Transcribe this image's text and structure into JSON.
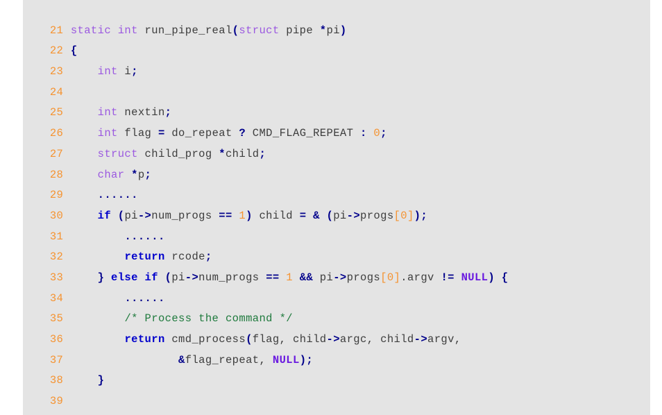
{
  "view": {
    "kind": "code-listing",
    "language": "C",
    "background_color": "#e4e4e4",
    "page_background_color": "#ffffff",
    "line_number_color": "#f59331",
    "plain_text_color": "#3d3d3d",
    "keyword_color": "#9b59e0",
    "control_keyword_color": "#0000cc",
    "operator_color": "#00008b",
    "number_color": "#f59331",
    "constant_color": "#6a1ae0",
    "comment_color": "#1f7a3d",
    "first_line_number": 21,
    "last_line_number": 39
  },
  "lines": [
    {
      "number": "21",
      "text": "static int run_pipe_real(struct pipe *pi)"
    },
    {
      "number": "22",
      "text": "{"
    },
    {
      "number": "23",
      "text": "    int i;"
    },
    {
      "number": "24",
      "text": ""
    },
    {
      "number": "25",
      "text": "    int nextin;"
    },
    {
      "number": "26",
      "text": "    int flag = do_repeat ? CMD_FLAG_REPEAT : 0;"
    },
    {
      "number": "27",
      "text": "    struct child_prog *child;"
    },
    {
      "number": "28",
      "text": "    char *p;"
    },
    {
      "number": "29",
      "text": "    ......"
    },
    {
      "number": "30",
      "text": "    if (pi->num_progs == 1) child = & (pi->progs[0]);"
    },
    {
      "number": "31",
      "text": "        ......"
    },
    {
      "number": "32",
      "text": "        return rcode;"
    },
    {
      "number": "33",
      "text": "    } else if (pi->num_progs == 1 && pi->progs[0].argv != NULL) {"
    },
    {
      "number": "34",
      "text": "        ......"
    },
    {
      "number": "35",
      "text": "        /* Process the command */"
    },
    {
      "number": "36",
      "text": "        return cmd_process(flag, child->argc, child->argv,"
    },
    {
      "number": "37",
      "text": "                &flag_repeat, NULL);"
    },
    {
      "number": "38",
      "text": "    }"
    },
    {
      "number": "39",
      "text": ""
    }
  ]
}
